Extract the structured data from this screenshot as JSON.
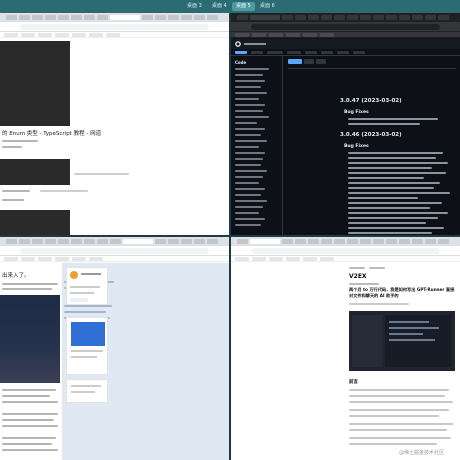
{
  "topbar": {
    "desktops": [
      {
        "label": "桌面 3",
        "active": false
      },
      {
        "label": "桌面 4",
        "active": false
      },
      {
        "label": "桌面 5",
        "active": true
      },
      {
        "label": "桌面 6",
        "active": false
      }
    ]
  },
  "top_left": {
    "heading": "的 Enum 类型 - TypeScript 教程 - 网道"
  },
  "top_right": {
    "repo_sidebar_title": "Code",
    "release_1": "3.0.47 (2023-03-02)",
    "release_1_section": "Bug Fixes",
    "release_2": "3.0.46 (2023-03-02)",
    "release_2_section": "Bug Fixes"
  },
  "bottom_left": {
    "heading": "出来入了。"
  },
  "bottom_right": {
    "logo": "V2EX",
    "title": "两个月 to 万行代码，我是如何写出 GPT-Runner 直接对文件和聊天的 AI 助手的",
    "section_label": "前言",
    "watermark": "@稀土掘金技术社区"
  },
  "colors": {
    "topbar": "#2b6b73",
    "desktop": "#1e3a44",
    "github_bg": "#0d1117",
    "github_accent": "#58a6ff",
    "v2ex_blue": "#2f6fd6"
  }
}
